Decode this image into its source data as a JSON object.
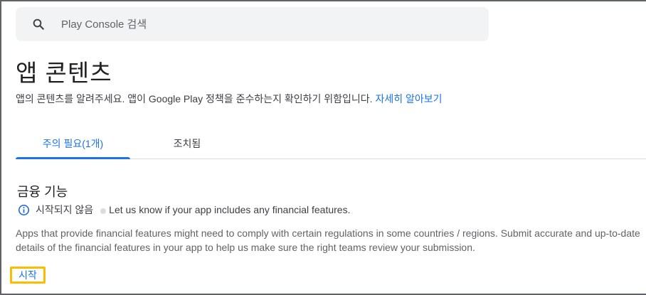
{
  "search": {
    "placeholder": "Play Console 검색",
    "icon": "search-icon"
  },
  "page": {
    "title": "앱 콘텐츠",
    "subtitle": "앱의 콘텐츠를 알려주세요. 앱이 Google Play 정책을 준수하는지 확인하기 위함입니다.",
    "learn_more": "자세히 알아보기"
  },
  "tabs": [
    {
      "label": "주의 필요(1개)",
      "active": true
    },
    {
      "label": "조치됨",
      "active": false
    }
  ],
  "section": {
    "title": "금융 기능",
    "status": "시작되지 않음",
    "status_icon": "info-icon",
    "prompt": "Let us know if your app includes any financial features.",
    "description": "Apps that provide financial features might need to comply with certain regulations in some countries / regions. Submit accurate and up-to-date details of the financial features in your app to help us make sure the right teams review your submission.",
    "start_label": "시작"
  },
  "colors": {
    "accent": "#1a73e8",
    "highlight": "#fbbc04",
    "search_bg": "#f1f3f4"
  }
}
